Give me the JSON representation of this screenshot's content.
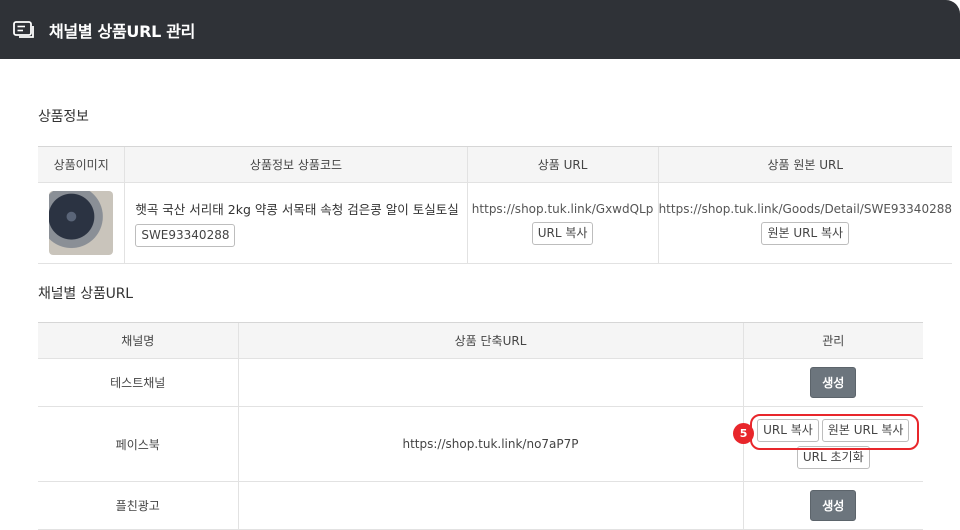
{
  "window": {
    "title": "채널별 상품URL 관리"
  },
  "product_section": {
    "title": "상품정보",
    "headers": [
      "상품이미지",
      "상품정보 상품코드",
      "상품 URL",
      "상품 원본 URL"
    ],
    "row": {
      "name": "햇곡 국산 서리태 2kg 약콩 서목태 속청 검은콩 알이 토실토실",
      "code": "SWE93340288",
      "url": "https://shop.tuk.link/GxwdQLp",
      "url_copy_label": "URL 복사",
      "origin_url": "https://shop.tuk.link/Goods/Detail/SWE93340288",
      "origin_copy_label": "원본 URL 복사"
    }
  },
  "channel_section": {
    "title": "채널별 상품URL",
    "headers": [
      "채널명",
      "상품 단축URL",
      "관리"
    ],
    "rows": [
      {
        "channel": "테스트채널",
        "short_url": "",
        "action": "생성"
      },
      {
        "channel": "페이스북",
        "short_url": "https://shop.tuk.link/no7aP7P",
        "copy": "URL 복사",
        "origin_copy": "원본 URL 복사",
        "reset": "URL 초기화"
      },
      {
        "channel": "플친광고",
        "short_url": "",
        "action": "생성"
      }
    ]
  },
  "annotation": {
    "step": "5",
    "color": "#e8262b"
  },
  "colors": {
    "titlebar": "#2f3237",
    "generate_button": "#6c757d"
  }
}
